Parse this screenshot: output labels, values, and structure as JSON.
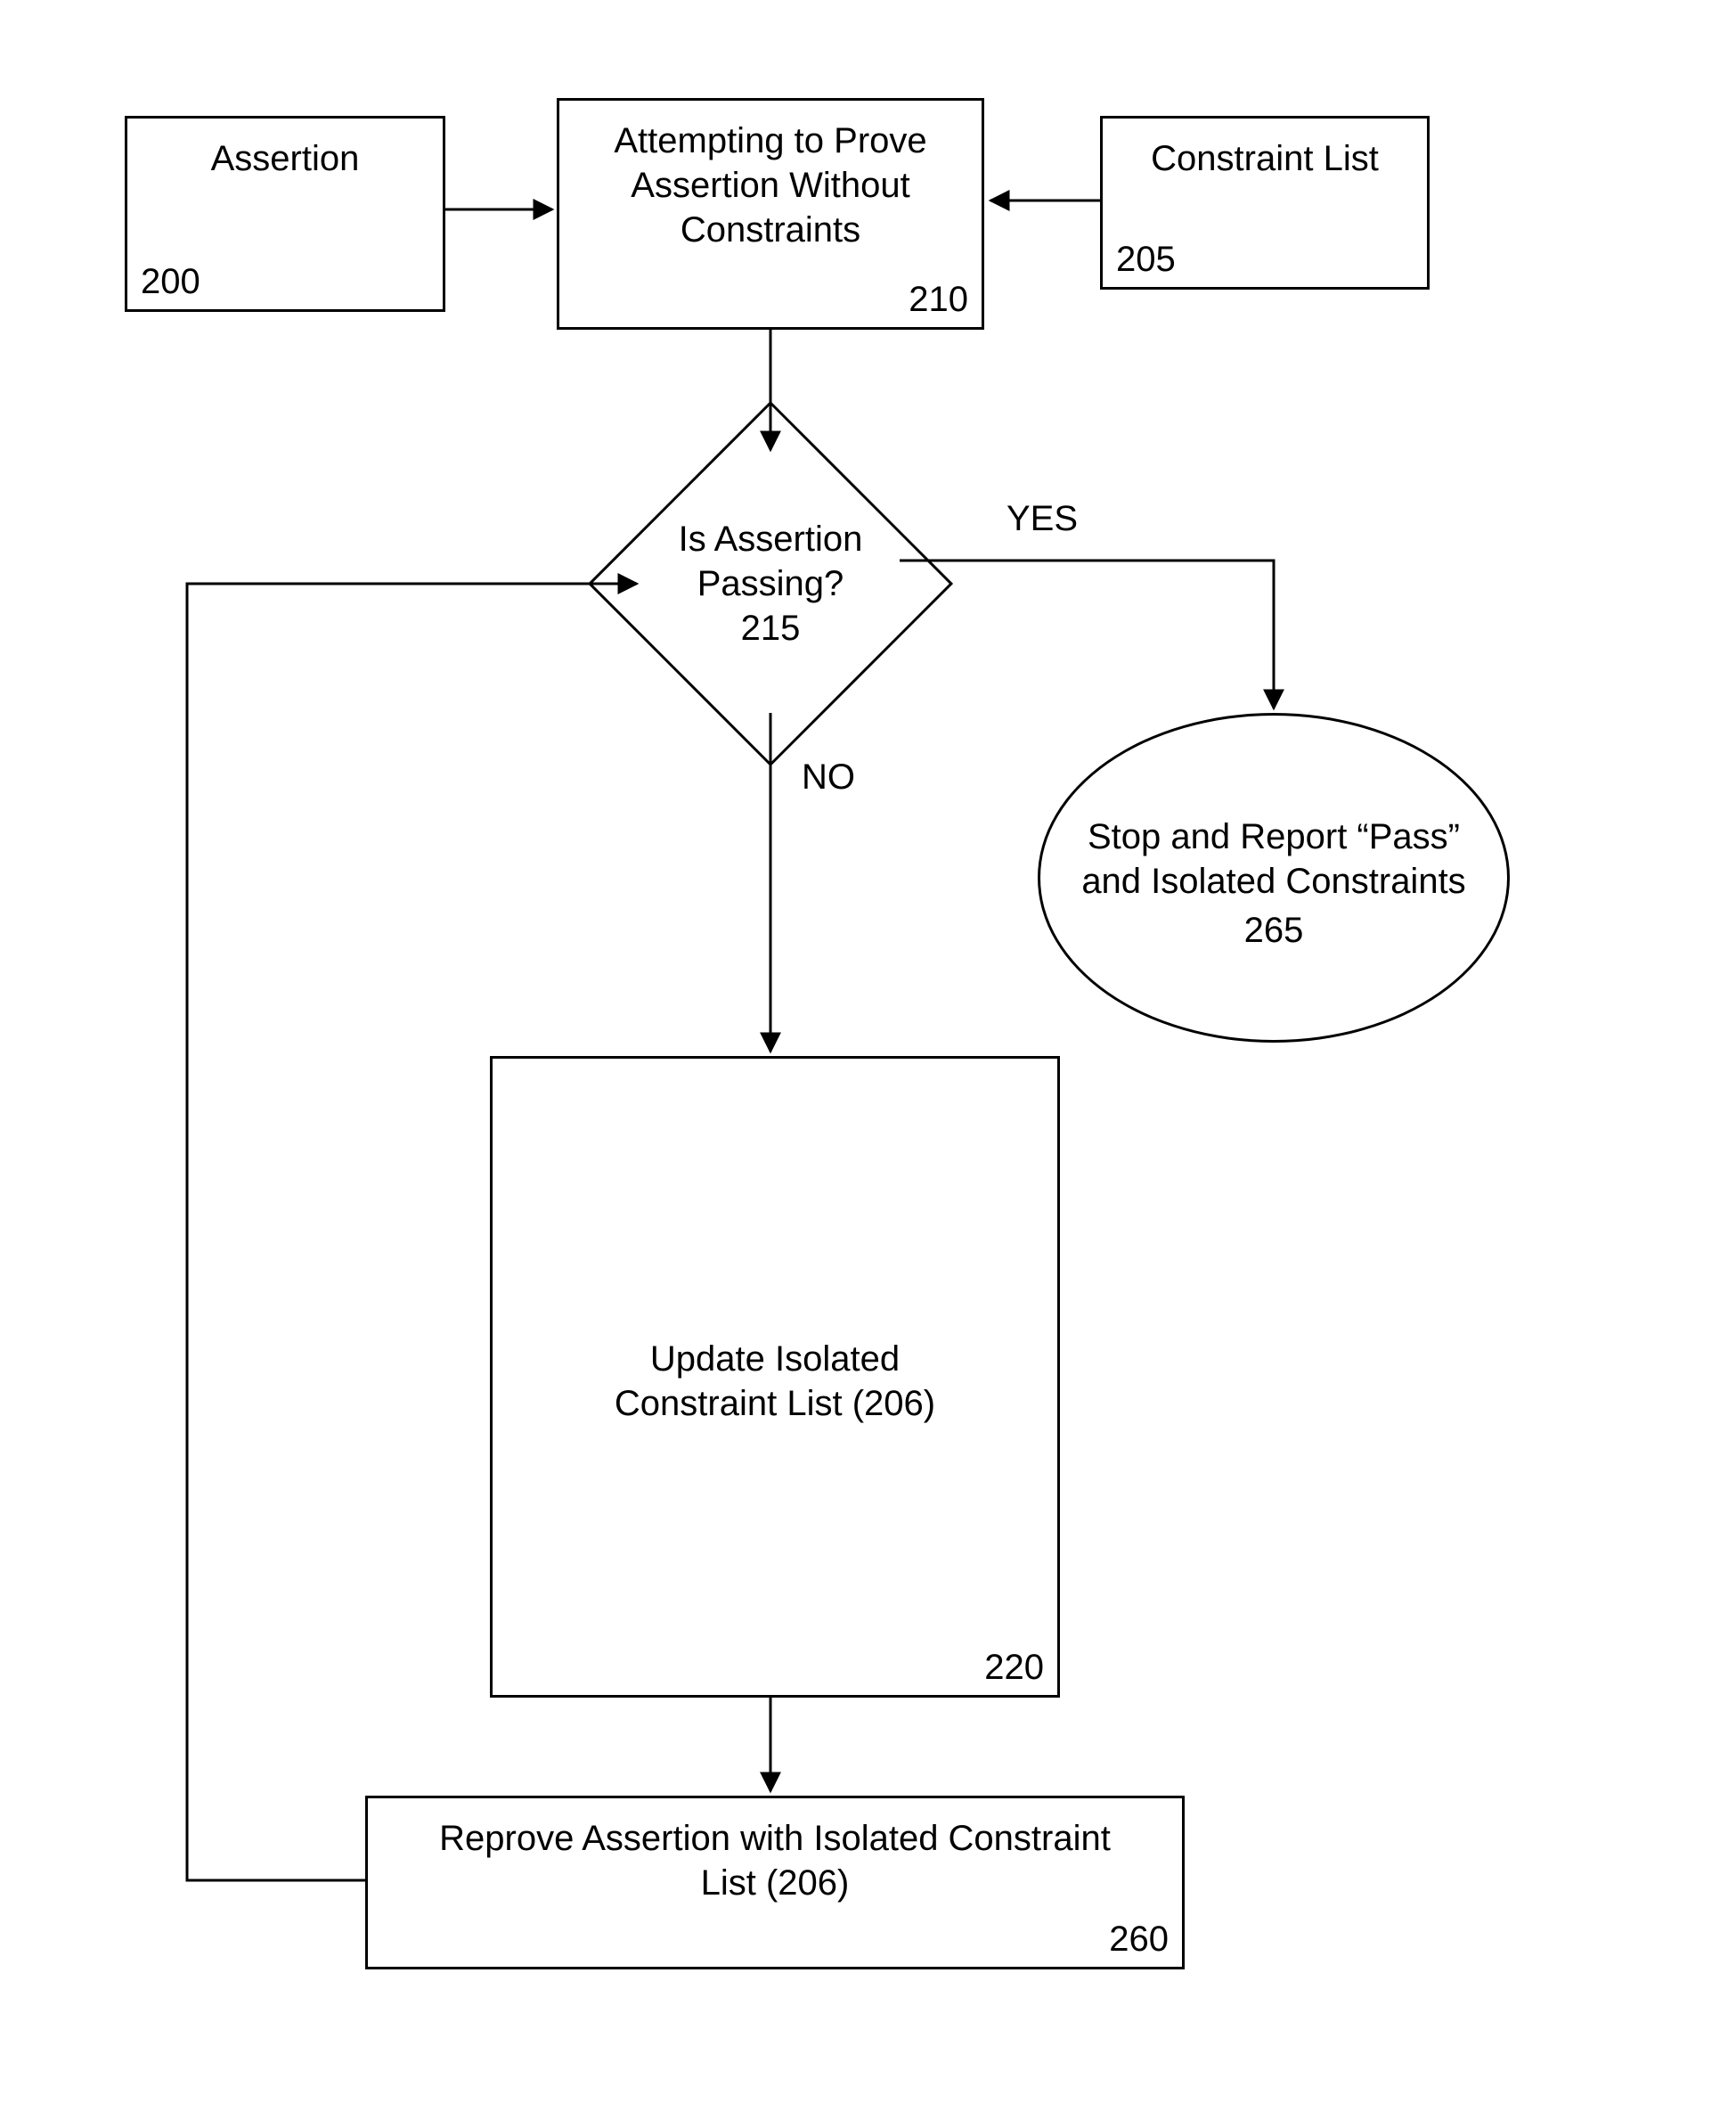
{
  "chart_data": {
    "type": "flowchart",
    "nodes": [
      {
        "id": "200",
        "shape": "rect",
        "label": "Assertion",
        "ref": "200"
      },
      {
        "id": "205",
        "shape": "rect",
        "label": "Constraint List",
        "ref": "205"
      },
      {
        "id": "210",
        "shape": "rect",
        "label": "Attempting to Prove Assertion Without Constraints",
        "ref": "210"
      },
      {
        "id": "215",
        "shape": "diamond",
        "label": "Is Assertion Passing?",
        "ref": "215"
      },
      {
        "id": "265",
        "shape": "ellipse",
        "label": "Stop and Report “Pass” and Isolated Constraints",
        "ref": "265"
      },
      {
        "id": "220",
        "shape": "rect",
        "label": "Update Isolated Constraint List (206)",
        "ref": "220"
      },
      {
        "id": "260",
        "shape": "rect",
        "label": "Reprove Assertion with Isolated Constraint List (206)",
        "ref": "260"
      }
    ],
    "edges": [
      {
        "from": "200",
        "to": "210"
      },
      {
        "from": "205",
        "to": "210"
      },
      {
        "from": "210",
        "to": "215"
      },
      {
        "from": "215",
        "to": "265",
        "label": "YES"
      },
      {
        "from": "215",
        "to": "220",
        "label": "NO"
      },
      {
        "from": "220",
        "to": "260"
      },
      {
        "from": "260",
        "to": "215"
      }
    ]
  },
  "nodes": {
    "n200": {
      "title": "Assertion",
      "ref": "200"
    },
    "n205": {
      "title": "Constraint List",
      "ref": "205"
    },
    "n210": {
      "title": "Attempting to Prove Assertion Without Constraints",
      "ref": "210"
    },
    "n215": {
      "title": "Is Assertion Passing?",
      "ref": "215"
    },
    "n265": {
      "title": "Stop and Report “Pass” and Isolated Constraints",
      "ref": "265"
    },
    "n220": {
      "title": "Update Isolated Constraint List (206)",
      "ref": "220"
    },
    "n260": {
      "title": "Reprove Assertion with Isolated Constraint List (206)",
      "ref": "260"
    }
  },
  "labels": {
    "yes": "YES",
    "no": "NO"
  }
}
